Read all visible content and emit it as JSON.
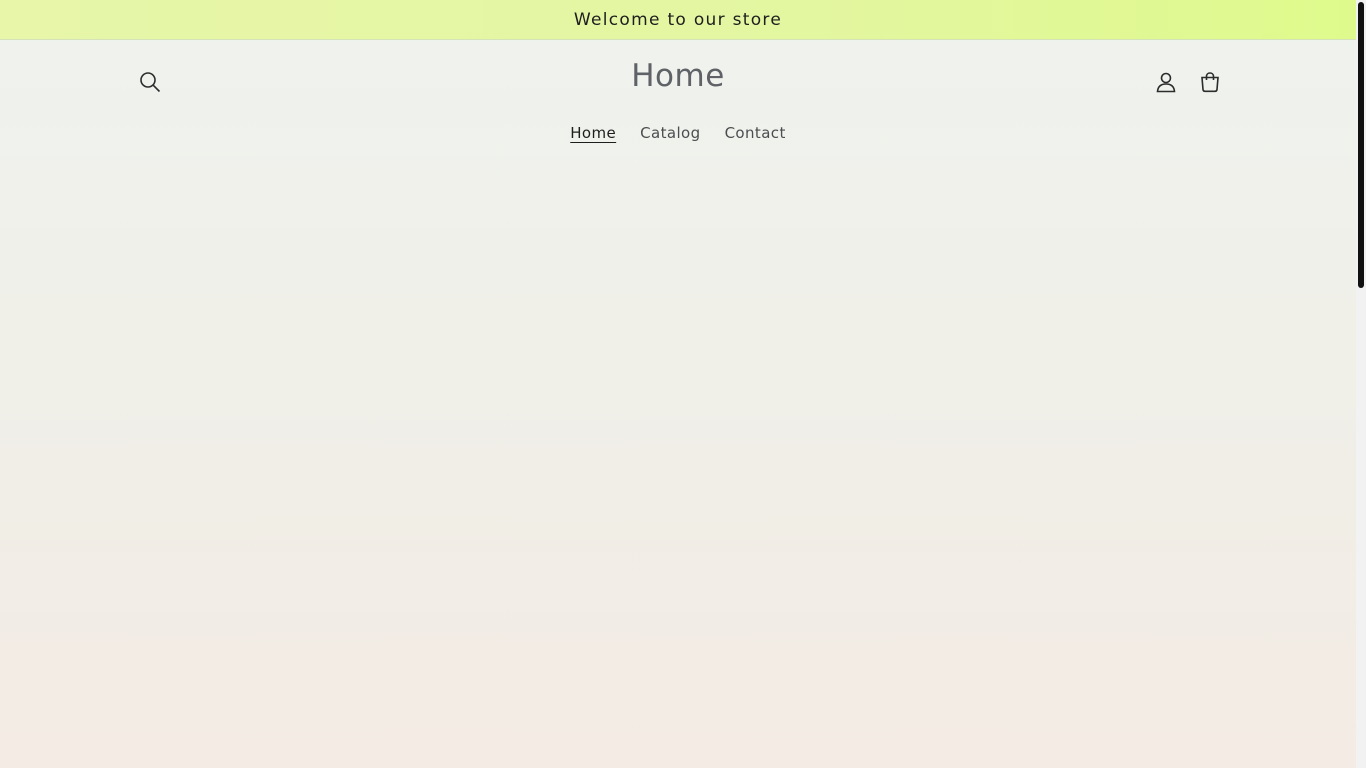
{
  "announcement": {
    "text": "Welcome to our store"
  },
  "header": {
    "title": "Home",
    "search_icon": "search-icon",
    "account_icon": "account-icon",
    "cart_icon": "cart-icon"
  },
  "nav": {
    "items": [
      {
        "label": "Home",
        "active": true
      },
      {
        "label": "Catalog",
        "active": false
      },
      {
        "label": "Contact",
        "active": false
      }
    ]
  },
  "colors": {
    "announcement_bg": "#e3f6a0",
    "text": "#1e1e1e",
    "title": "#5f6266",
    "scrollbar_thumb": "#111111"
  }
}
